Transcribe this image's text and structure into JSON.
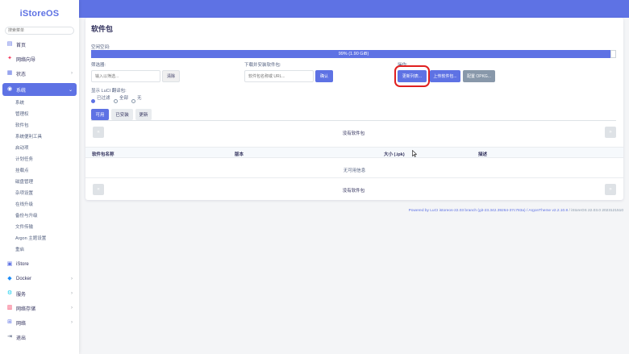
{
  "sidebar": {
    "logo": "iStoreOS",
    "search_placeholder": "搜索菜单",
    "items": [
      {
        "label": "首页",
        "icon": "home-icon"
      },
      {
        "label": "网络向导",
        "icon": "wizard-icon"
      },
      {
        "label": "状态",
        "icon": "status-icon"
      },
      {
        "label": "系统",
        "icon": "system-icon"
      },
      {
        "label": "iStore",
        "icon": "store-icon"
      },
      {
        "label": "Docker",
        "icon": "docker-icon"
      },
      {
        "label": "服务",
        "icon": "services-icon"
      },
      {
        "label": "网络存储",
        "icon": "nas-icon"
      },
      {
        "label": "网络",
        "icon": "network-icon"
      },
      {
        "label": "退出",
        "icon": "logout-icon"
      }
    ],
    "system_sub": [
      "系统",
      "管理权",
      "软件包",
      "系统便利工具",
      "启动项",
      "计划任务",
      "挂载点",
      "磁盘管理",
      "杂项设置",
      "在线升级",
      "备份与升级",
      "文件传输",
      "Argon 主题设置",
      "重启"
    ]
  },
  "main": {
    "title": "软件包",
    "space_label": "空闲空间:",
    "space_value": "99% (1.90 GiB)",
    "filter_label": "筛选器:",
    "filter_placeholder": "输入以筛选...",
    "clear_button": "清除",
    "download_label": "下载并安装软件包:",
    "download_placeholder": "软件包名称或 URL...",
    "ok_button": "确认",
    "actions_label": "操作:",
    "update_button": "更新列表...",
    "upload_button": "上传软件包...",
    "configure_button": "配置 OPKG...",
    "translation_label": "显示 LuCI 翻译包:",
    "radio_filtered": "已过滤",
    "radio_all": "全部",
    "radio_none": "无",
    "tabs": [
      "可用",
      "已安装",
      "更新"
    ],
    "no_packages": "没有软件包",
    "pager_prev": "«",
    "pager_next": "»",
    "columns": [
      "软件包名称",
      "版本",
      "大小 (.ipk)",
      "描述"
    ],
    "no_info": "无可用信息"
  },
  "footer": {
    "link": "Powered by LuCI istoreos-22.03 branch (git-23.342.39264-37c783a) / ArgonTheme v2.2.10.8",
    "version": " / iStoreOS 22.03.0 2023121510"
  },
  "colors": {
    "accent": "#5e72e4",
    "highlight": "#e02020"
  }
}
